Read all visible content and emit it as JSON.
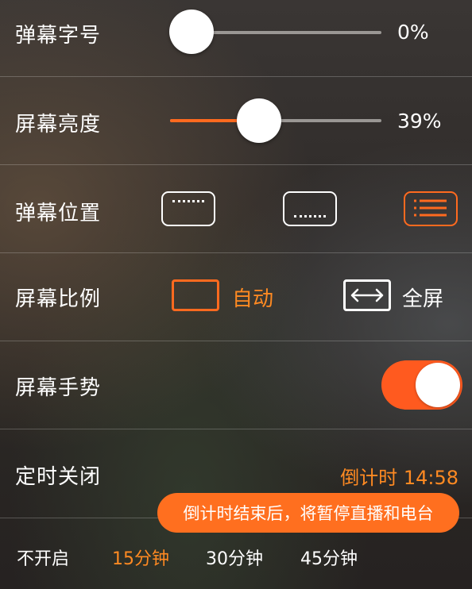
{
  "settings": {
    "danmu_size": {
      "label": "弹幕字号",
      "value_text": "0%",
      "value": 0
    },
    "brightness": {
      "label": "屏幕亮度",
      "value_text": "39%",
      "value": 0.39
    },
    "danmu_position": {
      "label": "弹幕位置",
      "options": [
        "top",
        "bottom",
        "full"
      ],
      "selected": "full"
    },
    "aspect_ratio": {
      "label": "屏幕比例",
      "auto_label": "自动",
      "full_label": "全屏",
      "selected": "auto"
    },
    "gesture": {
      "label": "屏幕手势",
      "enabled": true
    },
    "sleep_timer": {
      "label": "定时关闭",
      "countdown_label": "倒计时",
      "countdown_time": "14:58",
      "tooltip": "倒计时结束后，将暂停直播和电台",
      "options": [
        "不开启",
        "15分钟",
        "30分钟",
        "45分钟"
      ],
      "selected": "15分钟"
    }
  },
  "colors": {
    "accent": "#ff6a1f",
    "text": "#ffffff",
    "divider": "rgba(255,255,255,0.22)"
  }
}
